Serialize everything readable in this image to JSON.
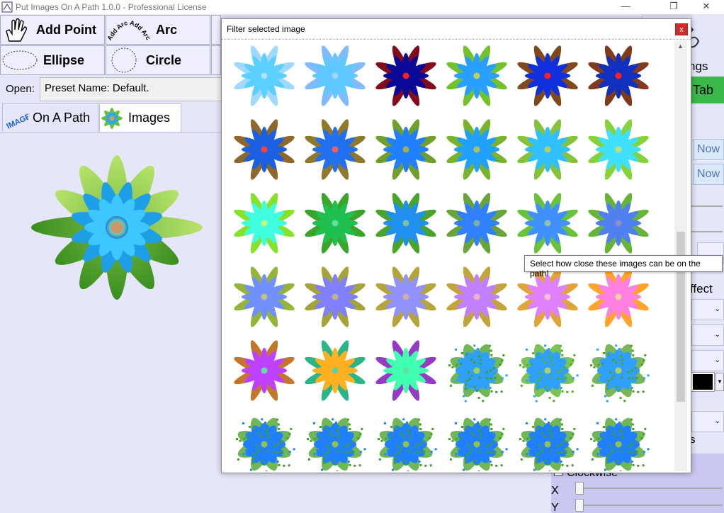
{
  "window": {
    "title": "Put Images On A Path 1.0.0 - Professional License",
    "minimize": "—",
    "restore": "❐",
    "close": "✕"
  },
  "toolbar": {
    "add_point": "Add Point",
    "arc": "Arc",
    "ellipse": "Ellipse",
    "circle": "Circle"
  },
  "open": {
    "label": "Open:",
    "value": "Preset Name: Default."
  },
  "tabs": [
    {
      "label": "On A Path"
    },
    {
      "label": "Images"
    }
  ],
  "right_panel": {
    "tab_partial": "Tab",
    "settings_partial": "ngs",
    "now1": "Now",
    "now2": "Now",
    "effect_partial": "ffect",
    "s_partial": "s",
    "clockwise": "Clockwise",
    "x_label": "X",
    "y_label": "Y"
  },
  "dialog": {
    "title": "Filter selected image",
    "close": "x"
  },
  "tooltip": {
    "text": "Select how close these images can be on the path!"
  },
  "images": {
    "rows": [
      [
        [
          "#5bd0ff",
          "#9ad8ff",
          "#b0e0ff"
        ],
        [
          "#5fc8ff",
          "#7ab8ff",
          "#9ad8ff"
        ],
        [
          "#0a0a9a",
          "#7a0010",
          "#ff2020"
        ],
        [
          "#29a0ff",
          "#6bc020",
          "#c0d060"
        ],
        [
          "#1030e0",
          "#7a4010",
          "#ff2020"
        ],
        [
          "#1030c0",
          "#7a3010",
          "#ff2020"
        ]
      ],
      [
        [
          "#1a60e0",
          "#8a6020",
          "#ff4040"
        ],
        [
          "#2070f0",
          "#8a7020",
          "#f06060"
        ],
        [
          "#2080ff",
          "#6a9a20",
          "#a0b050"
        ],
        [
          "#20a0ff",
          "#70b020",
          "#b0c060"
        ],
        [
          "#30c0ff",
          "#80c030",
          "#b0d070"
        ],
        [
          "#40e0ff",
          "#80d030",
          "#c0e080"
        ]
      ],
      [
        [
          "#40ffe0",
          "#80e020",
          "#c0ff80"
        ],
        [
          "#20c050",
          "#30a020",
          "#60e0a0"
        ],
        [
          "#2090f0",
          "#40a020",
          "#80c0a0"
        ],
        [
          "#3080ff",
          "#60a030",
          "#80b0a0"
        ],
        [
          "#4090ff",
          "#60c030",
          "#90c0b0"
        ],
        [
          "#5080f0",
          "#60b030",
          "#9090c0"
        ]
      ],
      [
        [
          "#7090ff",
          "#90b030",
          "#c0c080"
        ],
        [
          "#8080ff",
          "#a0a030",
          "#c0b090"
        ],
        [
          "#9090ff",
          "#b0a030",
          "#d0b0a0"
        ],
        [
          "#c080ff",
          "#c0a030",
          "#f0b0c0"
        ],
        [
          "#e080ff",
          "#e0a030",
          "#f0c0d0"
        ],
        [
          "#ff80e0",
          "#ffa020",
          "#ffd0a0"
        ]
      ],
      [
        [
          "#c040ff",
          "#c07020",
          "#60e0a0"
        ],
        [
          "#ffb020",
          "#20b080",
          "#60d0a0"
        ],
        [
          "#40ffb0",
          "#9030c0",
          "#60e0a0"
        ],
        [
          "#30a0ff",
          "#40a020",
          "#a0d050"
        ],
        [
          "#30a0ff",
          "#50b020",
          "#b0d060"
        ],
        [
          "#30a0ff",
          "#50a020",
          "#b0d060"
        ]
      ],
      [
        [
          "#2080ff",
          "#40a020",
          "#90c050"
        ],
        [
          "#2080ff",
          "#40a020",
          "#90c050"
        ],
        [
          "#2080ff",
          "#40a020",
          "#90c050"
        ],
        [
          "#2080ff",
          "#40a020",
          "#90c050"
        ],
        [
          "#2080ff",
          "#40a020",
          "#90c050"
        ],
        [
          "#2080ff",
          "#40a020",
          "#90c050"
        ]
      ]
    ]
  }
}
